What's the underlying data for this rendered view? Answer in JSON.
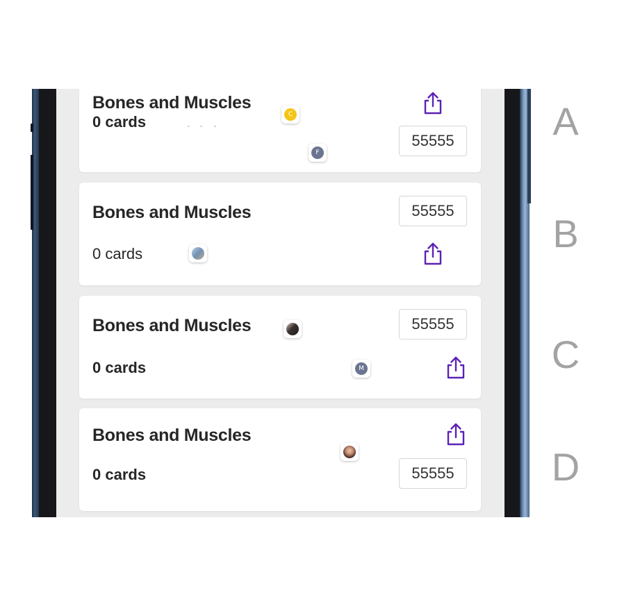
{
  "accent_color": "#5b21b6",
  "cards": [
    {
      "title": "Bones and Muscles",
      "count": "0 cards",
      "code": "55555",
      "share_icon": "share-icon",
      "avatars": [
        {
          "label": "C",
          "color": "#f5c518"
        },
        {
          "label": "F",
          "color": "#6b7591"
        }
      ]
    },
    {
      "title": "Bones and Muscles",
      "count": "0 cards",
      "code": "55555",
      "share_icon": "share-icon",
      "avatars": [
        {
          "label": "",
          "color": "#7a9fc0"
        }
      ]
    },
    {
      "title": "Bones and Muscles",
      "count": "0 cards",
      "code": "55555",
      "share_icon": "share-icon",
      "avatars": [
        {
          "label": "",
          "color": "#3a3030"
        },
        {
          "label": "M",
          "color": "#6b7591"
        }
      ]
    },
    {
      "title": "Bones and Muscles",
      "count": "0 cards",
      "code": "55555",
      "share_icon": "share-icon",
      "avatars": [
        {
          "label": "",
          "color": "#5a3a36"
        }
      ]
    }
  ],
  "options": [
    "A",
    "B",
    "C",
    "D"
  ]
}
